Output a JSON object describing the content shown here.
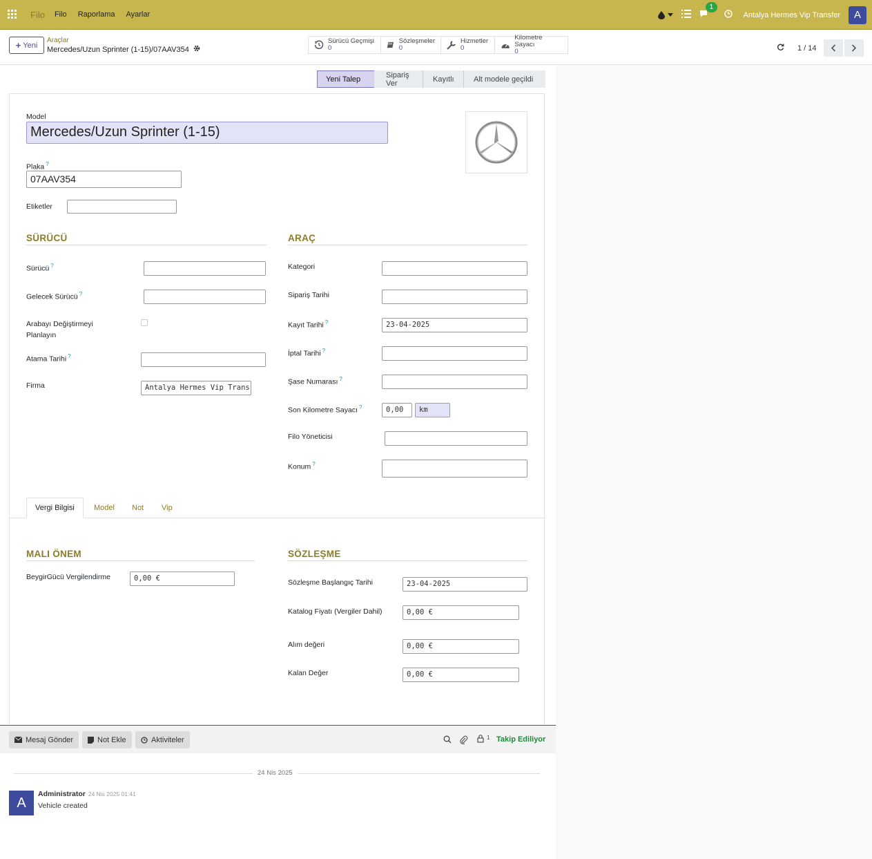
{
  "nav": {
    "brand": "Filo",
    "menu": [
      "Filo",
      "Raporlama",
      "Ayarlar"
    ],
    "chat_count": "1",
    "company": "Antalya Hermes Vip Transfer",
    "avatar": "A"
  },
  "cp": {
    "new_label": "Yeni",
    "breadcrumb_parent": "Araçlar",
    "breadcrumb_current": "Mercedes/Uzun Sprinter (1-15)/07AAV354",
    "smart": [
      {
        "icon": "history-icon",
        "title": "Sürücü Geçmişi",
        "value": "0"
      },
      {
        "icon": "book-icon",
        "title": "Sözleşmeler",
        "value": "0"
      },
      {
        "icon": "wrench-icon",
        "title": "Hizmetler",
        "value": "0"
      },
      {
        "icon": "tachometer-icon",
        "title": "Kilometre Sayacı",
        "value": "0"
      }
    ],
    "pager": "1 / 14"
  },
  "status": [
    "Yeni Talep",
    "Sipariş Ver",
    "Kayıtlı",
    "Alt modele geçildi"
  ],
  "form": {
    "model_label": "Model",
    "model_value": "Mercedes/Uzun Sprinter (1-15)",
    "plate_label": "Plaka",
    "plate_value": "07AAV354",
    "tags_label": "Etiketler",
    "driver_section": "SÜRÜCÜ",
    "vehicle_section": "ARAÇ",
    "driver": {
      "driver": "Sürücü",
      "future": "Gelecek Sürücü",
      "plan": "Arabayı Değiştirmeyi Planlayın",
      "assign": "Atama Tarihi",
      "company": "Firma",
      "company_value": "Antalya Hermes Vip Transfer"
    },
    "vehicle": {
      "category": "Kategori",
      "order_date": "Sipariş Tarihi",
      "reg_date": "Kayıt Tarihi",
      "reg_value": "23-04-2025",
      "cancel": "İptal Tarihi",
      "chassis": "Şase Numarası",
      "odometer": "Son Kilometre Sayacı",
      "odo_value": "0,00",
      "odo_unit": "km",
      "manager": "Filo Yöneticisi",
      "location": "Konum"
    }
  },
  "tabs": [
    "Vergi Bilgisi",
    "Model",
    "Not",
    "Vip"
  ],
  "tax": {
    "fiscal_section": "MALI ÖNEM",
    "contract_section": "SÖZLEŞME",
    "horse_label": "BeygirGücü Vergilendirme",
    "horse_value": "0,00 €",
    "contract_start": "Sözleşme Başlangıç Tarihi",
    "contract_start_value": "23-04-2025",
    "catalog": "Katalog Fiyatı (Vergiler Dahil)",
    "catalog_value": "0,00 €",
    "purchase": "Alım değeri",
    "purchase_value": "0,00 €",
    "residual": "Kalan Değer",
    "residual_value": "0,00 €"
  },
  "chatter": {
    "send": "Mesaj Gönder",
    "note": "Not Ekle",
    "activities": "Aktiviteler",
    "follower_count": "1",
    "following": "Takip Ediliyor",
    "date": "24 Nis 2025",
    "author": "Administrator",
    "msg_date": "24 Nis 2025 01:41",
    "body": "Vehicle created",
    "avatar": "A"
  }
}
